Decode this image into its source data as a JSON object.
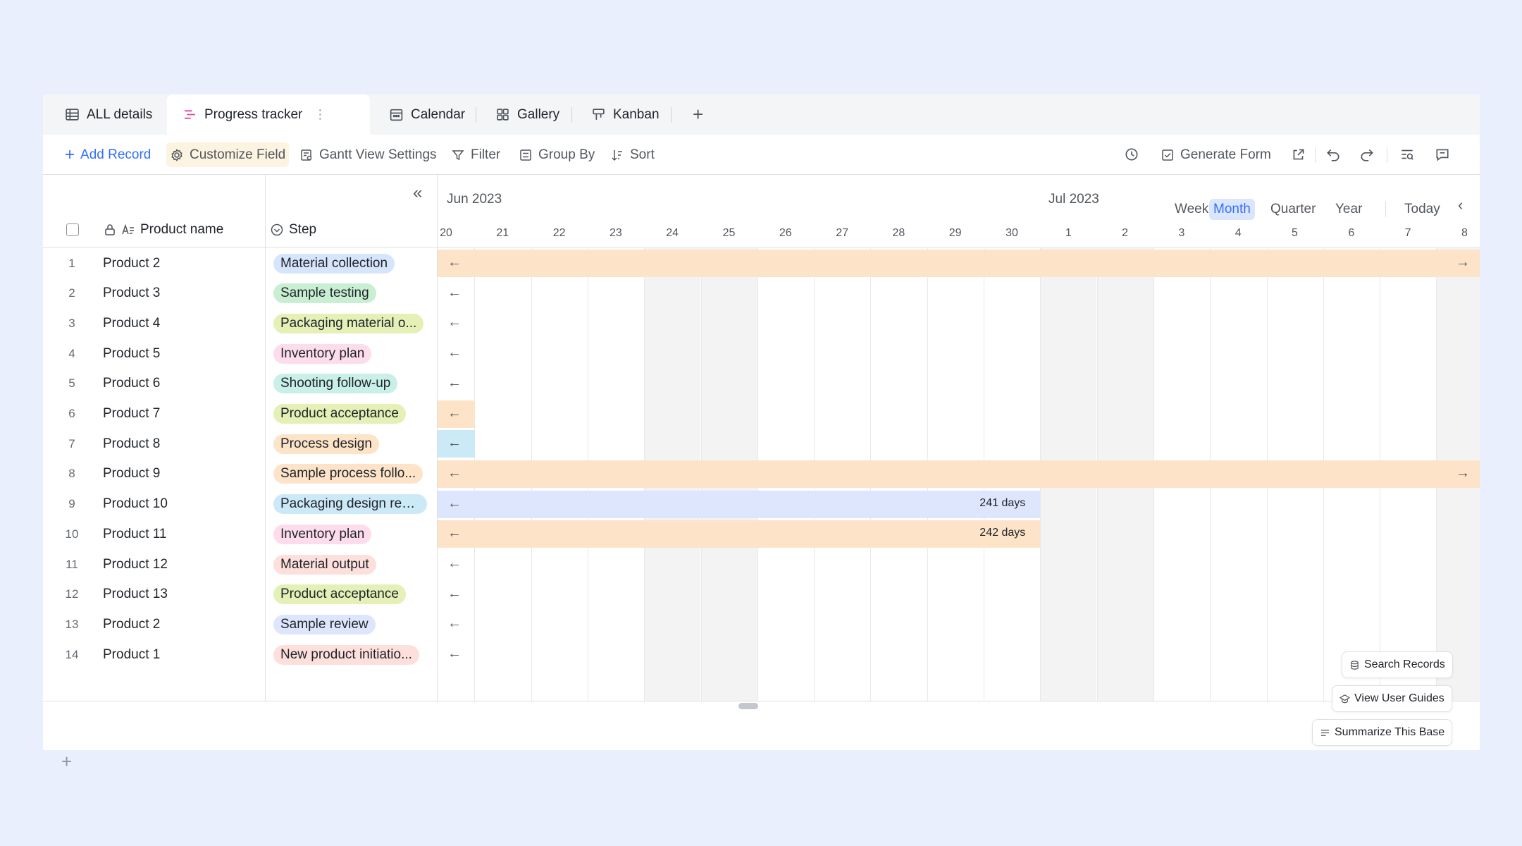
{
  "tabs": [
    {
      "label": "ALL details",
      "icon": "table-icon"
    },
    {
      "label": "Progress tracker",
      "icon": "gantt-icon",
      "active": true
    },
    {
      "label": "Calendar",
      "icon": "calendar-icon"
    },
    {
      "label": "Gallery",
      "icon": "gallery-icon"
    },
    {
      "label": "Kanban",
      "icon": "kanban-icon"
    }
  ],
  "toolbar": {
    "add_record": "Add Record",
    "customize_field": "Customize Field",
    "gantt_settings": "Gantt View Settings",
    "filter": "Filter",
    "group_by": "Group By",
    "sort": "Sort",
    "generate_form": "Generate Form"
  },
  "grid": {
    "col_product": "Product name",
    "col_step": "Step",
    "rows": [
      {
        "num": "1",
        "name": "Product 2",
        "step": "Material collection",
        "color": "#d6e5fc"
      },
      {
        "num": "2",
        "name": "Product 3",
        "step": "Sample testing",
        "color": "#c8efd2"
      },
      {
        "num": "3",
        "name": "Product 4",
        "step": "Packaging material o...",
        "color": "#e4f0b6"
      },
      {
        "num": "4",
        "name": "Product 5",
        "step": "Inventory plan",
        "color": "#fddcec"
      },
      {
        "num": "5",
        "name": "Product 6",
        "step": "Shooting follow-up",
        "color": "#c8efe8"
      },
      {
        "num": "6",
        "name": "Product 7",
        "step": "Product acceptance",
        "color": "#e4f0b6"
      },
      {
        "num": "7",
        "name": "Product 8",
        "step": "Process design",
        "color": "#fde4c8"
      },
      {
        "num": "8",
        "name": "Product 9",
        "step": "Sample process follo...",
        "color": "#fde4c8"
      },
      {
        "num": "9",
        "name": "Product 10",
        "step": "Packaging design revi...",
        "color": "#cce9f7"
      },
      {
        "num": "10",
        "name": "Product 11",
        "step": "Inventory plan",
        "color": "#fddcec"
      },
      {
        "num": "11",
        "name": "Product 12",
        "step": "Material output",
        "color": "#fde0dc"
      },
      {
        "num": "12",
        "name": "Product 13",
        "step": "Product acceptance",
        "color": "#e4f0b6"
      },
      {
        "num": "13",
        "name": "Product 2",
        "step": "Sample review",
        "color": "#dde6fc"
      },
      {
        "num": "14",
        "name": "Product 1",
        "step": "New product initiatio...",
        "color": "#fde0dc"
      }
    ]
  },
  "gantt": {
    "month_left": "Jun 2023",
    "month_right": "Jul 2023",
    "views": [
      "Week",
      "Month",
      "Quarter",
      "Year"
    ],
    "selected_view": "Month",
    "today": "Today",
    "days": [
      "20",
      "21",
      "22",
      "23",
      "24",
      "25",
      "26",
      "27",
      "28",
      "29",
      "30",
      "1",
      "2",
      "3",
      "4",
      "5",
      "6",
      "7",
      "8"
    ],
    "weekend_days": [
      "24",
      "25",
      "1",
      "2",
      "8"
    ],
    "bar_colors": {
      "peach": "#fde4c8",
      "lavender": "#dde6fc",
      "cyan": "#cce9f7"
    },
    "bars": [
      {
        "row": 1,
        "color": "peach",
        "extends": "both"
      },
      {
        "row": 6,
        "color": "peach",
        "extends": "left"
      },
      {
        "row": 7,
        "color": "cyan",
        "extends": "left"
      },
      {
        "row": 8,
        "color": "peach",
        "extends": "both"
      },
      {
        "row": 9,
        "color": "lavender",
        "end_day": "30",
        "label": "241 days"
      },
      {
        "row": 10,
        "color": "peach",
        "end_day": "30",
        "label": "242 days"
      }
    ]
  },
  "floating": {
    "search": "Search Records",
    "guides": "View User Guides",
    "summarize": "Summarize This Base"
  }
}
